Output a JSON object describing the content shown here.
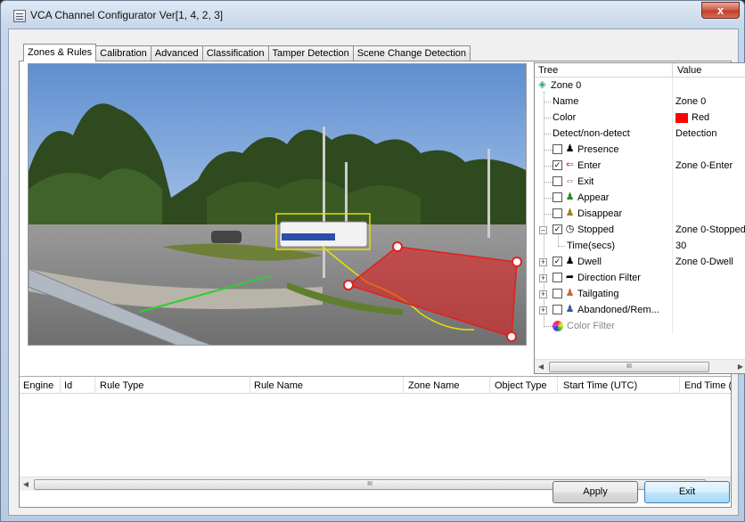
{
  "window": {
    "title": "VCA Channel Configurator Ver[1, 4, 2, 3]",
    "close_label": "x"
  },
  "tabs": [
    {
      "label": "Zones & Rules",
      "active": true
    },
    {
      "label": "Calibration",
      "active": false
    },
    {
      "label": "Advanced",
      "active": false
    },
    {
      "label": "Classification",
      "active": false
    },
    {
      "label": "Tamper Detection",
      "active": false
    },
    {
      "label": "Scene Change Detection",
      "active": false
    }
  ],
  "tree": {
    "col_tree": "Tree",
    "col_value": "Value",
    "zone_label": "Zone 0",
    "props": {
      "name_label": "Name",
      "name_value": "Zone 0",
      "color_label": "Color",
      "color_value": "Red",
      "color_hex": "#ff0000",
      "detect_label": "Detect/non-detect",
      "detect_value": "Detection"
    },
    "rules": {
      "presence": {
        "label": "Presence",
        "checked": false,
        "value": ""
      },
      "enter": {
        "label": "Enter",
        "checked": true,
        "value": "Zone 0-Enter"
      },
      "exit": {
        "label": "Exit",
        "checked": false,
        "value": ""
      },
      "appear": {
        "label": "Appear",
        "checked": false,
        "value": ""
      },
      "disappear": {
        "label": "Disappear",
        "checked": false,
        "value": ""
      },
      "stopped": {
        "label": "Stopped",
        "checked": true,
        "value": "Zone 0-Stopped"
      },
      "time": {
        "label": "Time(secs)",
        "value": "30"
      },
      "dwell": {
        "label": "Dwell",
        "checked": true,
        "value": "Zone 0-Dwell"
      },
      "direction": {
        "label": "Direction Filter",
        "checked": false,
        "value": ""
      },
      "tailgating": {
        "label": "Tailgating",
        "checked": false,
        "value": ""
      },
      "abandoned": {
        "label": "Abandoned/Rem...",
        "checked": false,
        "value": ""
      },
      "color_filter": {
        "label": "Color Filter"
      }
    },
    "scroll_thumb": "III"
  },
  "events_table": {
    "columns": [
      "Engine",
      "Id",
      "Rule Type",
      "Rule Name",
      "Zone Name",
      "Object Type",
      "Start Time (UTC)",
      "End Time ("
    ],
    "rows": [],
    "scroll_thumb": "III"
  },
  "buttons": {
    "apply": "Apply",
    "exit": "Exit"
  },
  "scene": {
    "zone_color": "#e02020",
    "tracker_box_color": "#e8e000",
    "tripwire_color": "#33cc33",
    "path_color": "#e8e000"
  }
}
